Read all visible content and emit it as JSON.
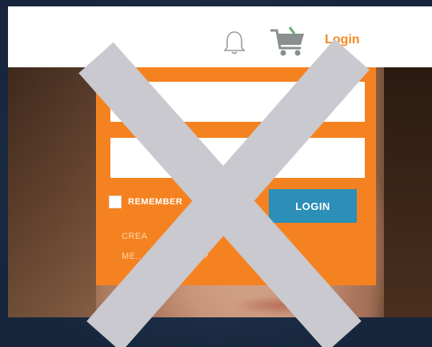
{
  "header": {
    "login_label": "Login",
    "icons": [
      "bell-icon",
      "shopping-cart-icon"
    ]
  },
  "login_panel": {
    "username_value": "",
    "password_value": "",
    "remember_label": "REMEMBER",
    "login_button_label": "LOGIN",
    "create_link": "CREA",
    "forgot_link": "ME... LOGGING IN?"
  },
  "overlay": {
    "icon": "cross-out-icon"
  },
  "colors": {
    "accent": "#f58220",
    "button": "#2b8fb8",
    "overlay_x": "#c9c9cf",
    "background": "#1c2d46"
  }
}
